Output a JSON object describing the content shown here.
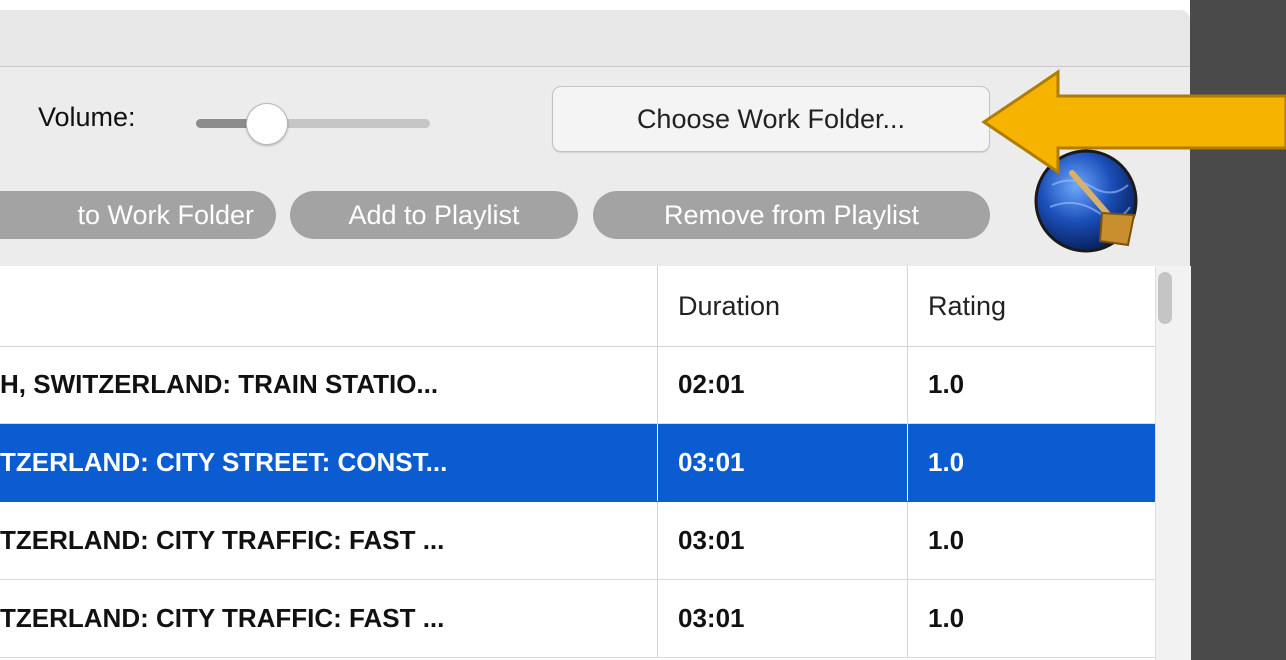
{
  "toolbar": {
    "volume_label": "Volume:",
    "volume_level": 0.3,
    "choose_folder_label": "Choose Work Folder...",
    "buttons": [
      {
        "label": "to Work Folder"
      },
      {
        "label": "Add to Playlist"
      },
      {
        "label": "Remove from Playlist"
      }
    ]
  },
  "table": {
    "columns": [
      "",
      "Duration",
      "Rating"
    ],
    "rows": [
      {
        "name": "H, SWITZERLAND: TRAIN STATIO...",
        "duration": "02:01",
        "rating": "1.0",
        "selected": false
      },
      {
        "name": "TZERLAND: CITY STREET: CONST...",
        "duration": "03:01",
        "rating": "1.0",
        "selected": true
      },
      {
        "name": "TZERLAND: CITY TRAFFIC: FAST ...",
        "duration": "03:01",
        "rating": "1.0",
        "selected": false
      },
      {
        "name": "TZERLAND: CITY TRAFFIC: FAST ...",
        "duration": "03:01",
        "rating": "1.0",
        "selected": false
      }
    ]
  },
  "colors": {
    "selection": "#0b5bd1",
    "arrow": "#f6b400",
    "pill_button": "#a3a3a3"
  },
  "icons": [
    "app-shovel-icon",
    "pointer-arrow-icon"
  ]
}
